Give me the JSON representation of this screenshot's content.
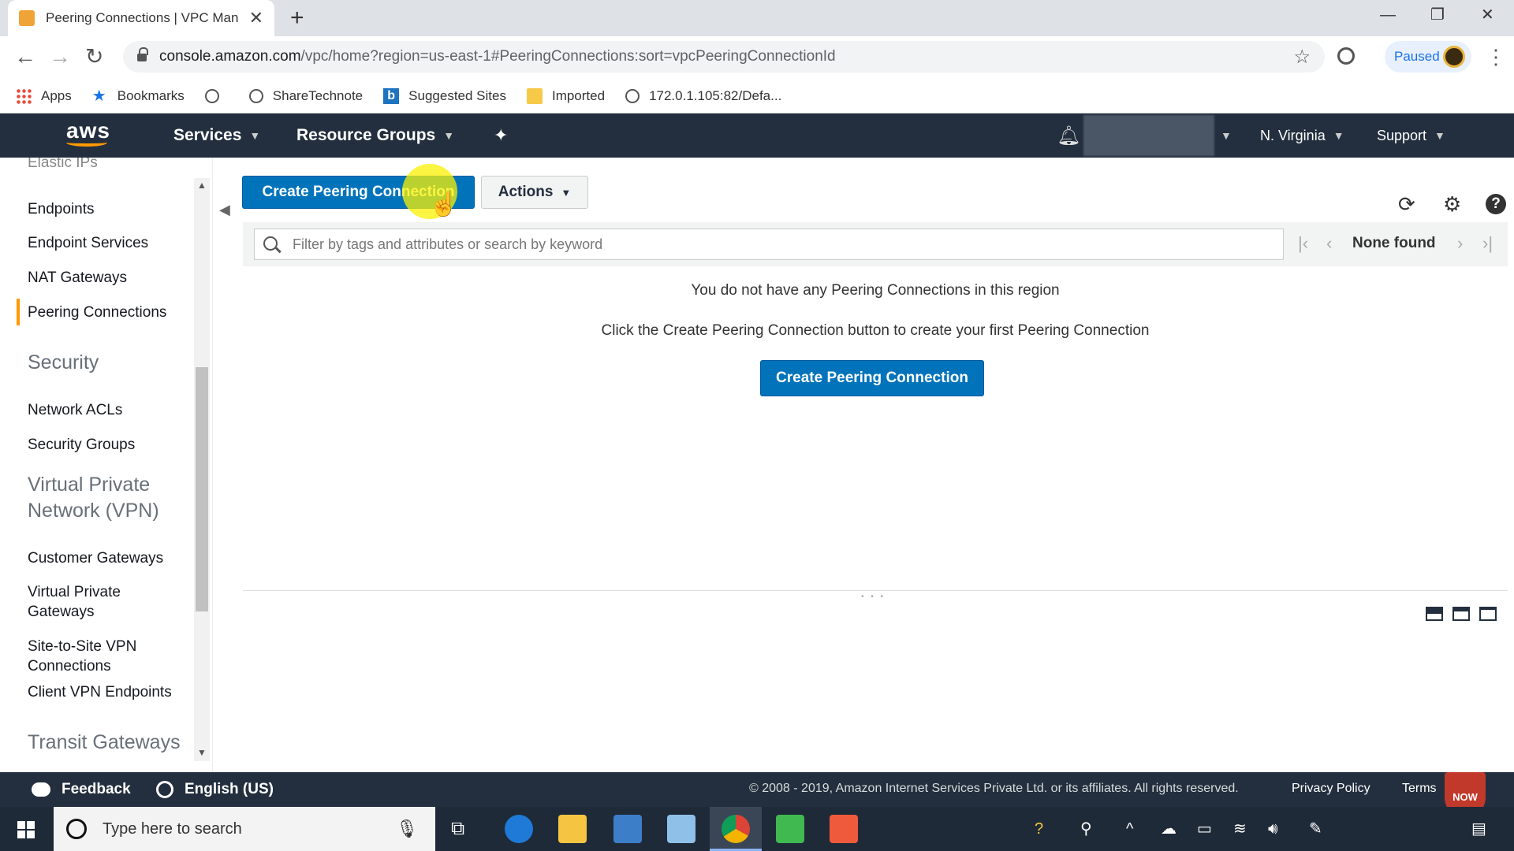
{
  "browser": {
    "tab_title": "Peering Connections | VPC Management Console",
    "tab_close": "✕",
    "new_tab": "+",
    "url_host": "console.amazon.com",
    "url_path": "/vpc/home?region=us-east-1#PeeringConnections:sort=vpcPeeringConnectionId",
    "profile_status": "Paused",
    "window_controls": {
      "minimize": "—",
      "restore": "❐",
      "close": "✕"
    },
    "bookmarks": [
      {
        "label": "Apps",
        "icon": "apps-grid-icon"
      },
      {
        "label": "Bookmarks",
        "icon": "star-icon"
      },
      {
        "label": "",
        "icon": "globe-icon"
      },
      {
        "label": "ShareTechnote",
        "icon": "globe-icon"
      },
      {
        "label": "Suggested Sites",
        "icon": "bing-icon"
      },
      {
        "label": "Imported",
        "icon": "folder-icon"
      },
      {
        "label": "172.0.1.105:82/Defa...",
        "icon": "globe-icon"
      }
    ]
  },
  "aws_header": {
    "logo": "aws",
    "services": "Services",
    "resource_groups": "Resource Groups",
    "region": "N. Virginia",
    "support": "Support"
  },
  "sidebar": {
    "items": [
      {
        "label": "Elastic IPs"
      },
      {
        "label": "Endpoints"
      },
      {
        "label": "Endpoint Services"
      },
      {
        "label": "NAT Gateways"
      },
      {
        "label": "Peering Connections",
        "active": true
      }
    ],
    "security_heading": "Security",
    "security_items": [
      {
        "label": "Network ACLs"
      },
      {
        "label": "Security Groups"
      }
    ],
    "vpn_heading": "Virtual Private Network (VPN)",
    "vpn_items": [
      {
        "label": "Customer Gateways"
      },
      {
        "label": "Virtual Private Gateways"
      },
      {
        "label": "Site-to-Site VPN Connections"
      },
      {
        "label": "Client VPN Endpoints"
      }
    ],
    "transit_heading": "Transit Gateways"
  },
  "main": {
    "create_button": "Create Peering Connection",
    "actions_button": "Actions",
    "filter_placeholder": "Filter by tags and attributes or search by keyword",
    "pagination_status": "None found",
    "empty_message": "You do not have any Peering Connections in this region",
    "empty_hint": "Click the Create Peering Connection button to create your first Peering Connection",
    "empty_create_button": "Create Peering Connection"
  },
  "footer": {
    "feedback": "Feedback",
    "language": "English (US)",
    "copyright": "© 2008 - 2019, Amazon Internet Services Private Ltd. or its affiliates. All rights reserved.",
    "privacy": "Privacy Policy",
    "terms": "Terms",
    "badge": "NOW"
  },
  "taskbar": {
    "search_placeholder": "Type here to search"
  },
  "colors": {
    "aws_nav": "#232f3e",
    "aws_orange": "#ff9900",
    "primary_button": "#0073bb"
  }
}
